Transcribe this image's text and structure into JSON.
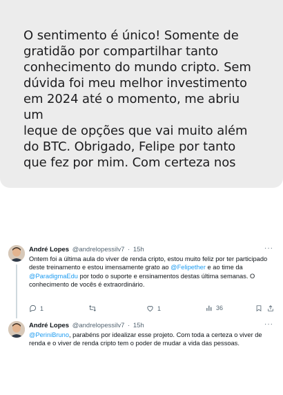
{
  "message": {
    "text": "O sentimento é único! Somente de\ngratidão por compartilhar tanto\nconhecimento do mundo cripto. Sem\ndúvida foi meu melhor investimento\nem 2024 até o momento, me abriu um\nleque de opções que vai muito além\ndo BTC. Obrigado, Felipe por tanto\nque fez por mim. Com certeza nos"
  },
  "tweets": [
    {
      "author": "André Lopes",
      "handle": "@andrelopessilv7",
      "separator": "·",
      "time": "15h",
      "body": [
        "Ontem foi a última aula do viver de renda cripto, estou muito feliz por ter participado deste treinamento e estou imensamente grato ao ",
        "@Felipether",
        " e ao time da ",
        "@ParadigmaEdu",
        " por todo o suporte e ensinamentos destas última semanas. O conhecimento de vocês é extraordinário."
      ],
      "actions": {
        "reply_count": "1",
        "retweet_count": "",
        "like_count": "1",
        "views_count": "36"
      }
    },
    {
      "author": "André Lopes",
      "handle": "@andrelopessilv7",
      "separator": "·",
      "time": "15h",
      "body": [
        "@PeriniBruno",
        ", parabéns por idealizar esse projeto. Com toda a certeza o viver de renda e o viver de renda cripto tem o poder de mudar a vida das pessoas."
      ]
    }
  ],
  "icons": {
    "more": "more-horizontal-icon",
    "reply": "reply-icon",
    "retweet": "retweet-icon",
    "like": "heart-icon",
    "views": "views-icon",
    "bookmark": "bookmark-icon",
    "share": "share-icon"
  },
  "colors": {
    "bubble": "#ececec",
    "mention": "#1d9bf0",
    "muted": "#536471",
    "thread_line": "#cfd9de"
  }
}
